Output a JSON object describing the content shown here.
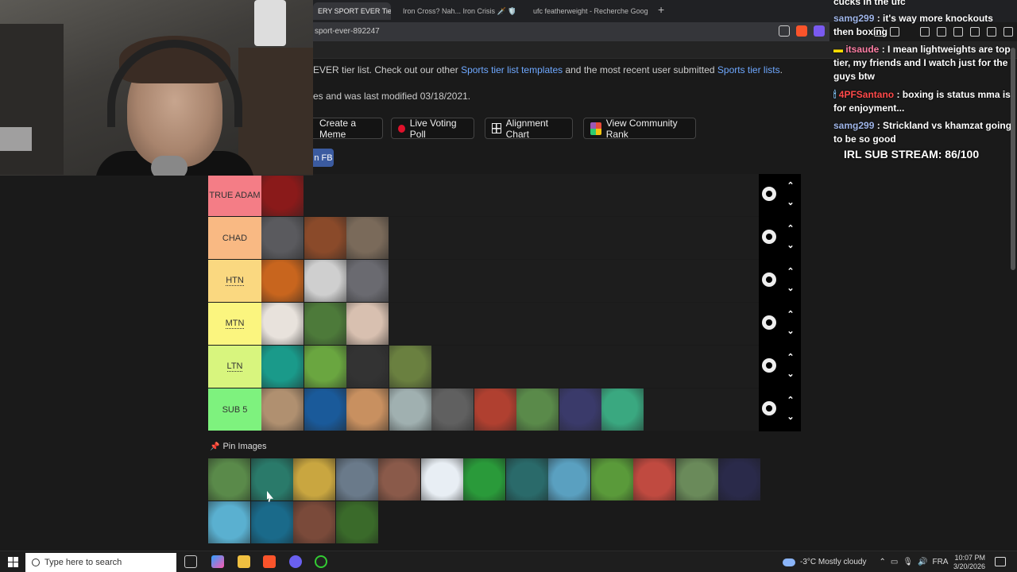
{
  "browser": {
    "tabs": [
      {
        "label": "ERY SPORT EVER Tie",
        "active": true
      },
      {
        "label": "Iron Cross? Nah... Iron Crisis 🗡️ 🛡️ #",
        "active": false
      },
      {
        "label": "ufc featherweight - Recherche Googl",
        "active": false
      }
    ],
    "url": "sport-ever-892247"
  },
  "page": {
    "intro_text_1": "EVER tier list. Check out our other ",
    "intro_link_1": "Sports tier list templates",
    "intro_text_2": " and the most recent user submitted ",
    "intro_link_2": "Sports tier lists",
    "intro_text_3": ".",
    "modified_text": "es and was last modified 03/18/2021.",
    "buttons": {
      "create_meme": "Create a Meme",
      "live_voting": "Live Voting Poll",
      "alignment": "Alignment Chart",
      "community": "View Community Rank"
    },
    "fb_label": "n FB"
  },
  "tiers": [
    {
      "label": "TRUE ADAM",
      "color": "#f47d86",
      "dotted": false,
      "tiles": [
        "#8a1a1a"
      ]
    },
    {
      "label": "CHAD",
      "color": "#f9b983",
      "dotted": false,
      "tiles": [
        "#5a5a5e",
        "#8a4a2a",
        "#7a6a5a"
      ]
    },
    {
      "label": "HTN",
      "color": "#fad880",
      "dotted": true,
      "tiles": [
        "#c8651e",
        "#cfcfcf",
        "#6a6a70"
      ]
    },
    {
      "label": "MTN",
      "color": "#fbf57f",
      "dotted": true,
      "tiles": [
        "#e8e2dc",
        "#4d7a3a",
        "#d8c0b0"
      ]
    },
    {
      "label": "LTN",
      "color": "#d8f57e",
      "dotted": true,
      "tiles": [
        "#1a9a8a",
        "#6aa640",
        "#333333",
        "#6a8040"
      ]
    },
    {
      "label": "SUB 5",
      "color": "#7ef27e",
      "dotted": false,
      "tiles": [
        "#b09070",
        "#1a5a9a",
        "#c89060",
        "#a0b0b0",
        "#606060",
        "#b04030",
        "#5a8a4a",
        "#3a3a6a",
        "#3aa880"
      ]
    }
  ],
  "pin": {
    "label": "Pin Images",
    "pool": [
      "#5a8a4a",
      "#2a7a6a",
      "#c9a640",
      "#6a7a8a",
      "#8a5a4a",
      "#e8eef4",
      "#2a9a3a",
      "#2a6a6a",
      "#5aa0c0",
      "#5a9a3a",
      "#c04a40",
      "#6a8a5a",
      "#2a2a4a",
      "#5ab0d0",
      "#1a6a8a",
      "#7a4a3a",
      "#3a6a2a"
    ]
  },
  "chat": {
    "lines": [
      {
        "user": "",
        "user_style": "",
        "text": "cucks in the ufc"
      },
      {
        "user": "samg299",
        "user_style": "",
        "text": ": it's way more knockouts then boxing"
      },
      {
        "user": "itsaude",
        "user_style": "pink",
        "text": ": I mean lightweights are top tier, my friends and I watch just for the guys btw"
      },
      {
        "user": "4PFSantano",
        "user_style": "red",
        "text": ": boxing is status mma is for enjoyment..."
      },
      {
        "user": "samg299",
        "user_style": "",
        "text": ": Strickland vs khamzat going to be so good"
      }
    ],
    "sub_goal": "IRL SUB STREAM: 86/100"
  },
  "taskbar": {
    "search_placeholder": "Type here to search",
    "weather": "-3°C  Mostly cloudy",
    "lang": "FRA",
    "time": "10:07 PM",
    "date": "3/20/2026"
  }
}
